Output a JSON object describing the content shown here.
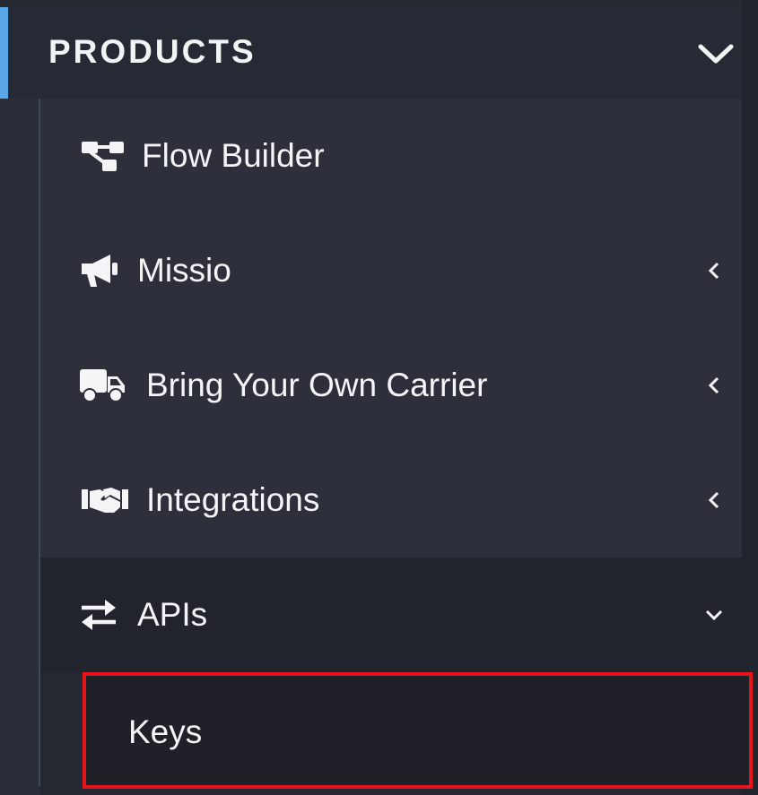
{
  "section": {
    "title": "PRODUCTS",
    "chevron_icon": "chevron-down-icon"
  },
  "menu": {
    "items": [
      {
        "label": "Flow Builder",
        "icon": "sitemap-icon"
      },
      {
        "label": "Missio",
        "icon": "megaphone-icon",
        "caret": "chevron-left-icon"
      },
      {
        "label": "Bring Your Own Carrier",
        "icon": "truck-icon",
        "caret": "chevron-left-icon"
      },
      {
        "label": "Integrations",
        "icon": "handshake-icon",
        "caret": "chevron-left-icon"
      },
      {
        "label": "APIs",
        "icon": "exchange-arrows-icon",
        "caret": "chevron-down-icon"
      }
    ],
    "submenu": [
      {
        "label": "Keys"
      }
    ]
  },
  "colors": {
    "accent": "#5aa6e6",
    "highlight_border": "#e8141c",
    "text": "#f4f5f7"
  }
}
